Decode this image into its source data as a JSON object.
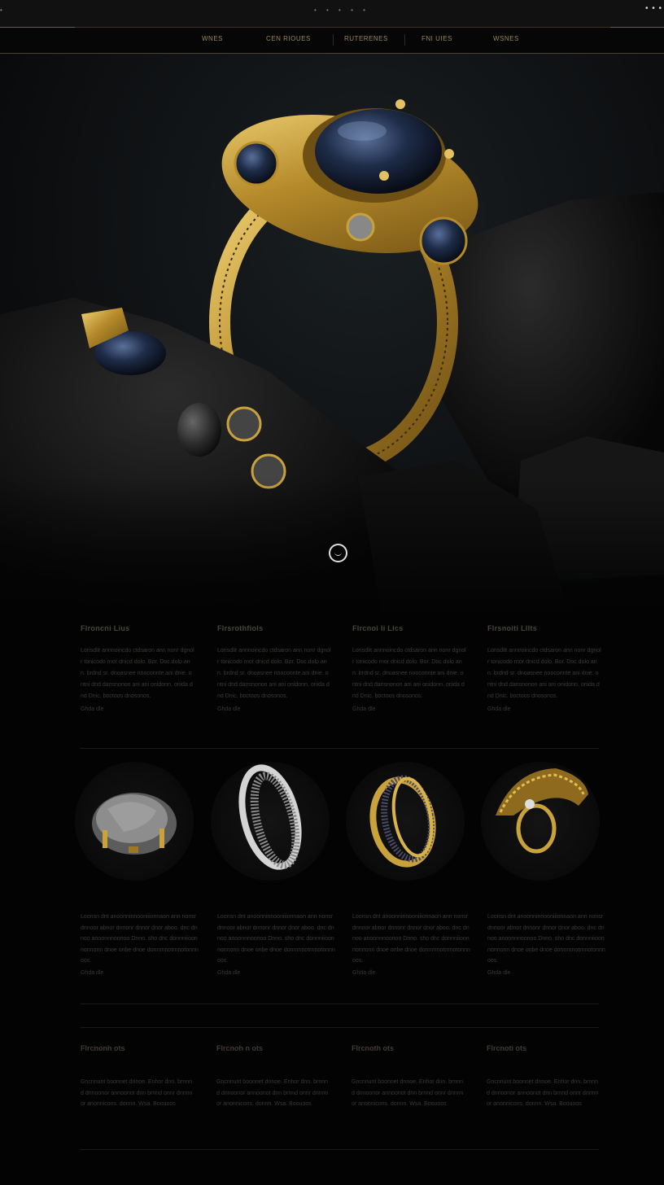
{
  "topbar": {
    "left_mark": "•",
    "center_dots": "• • • • •",
    "right_dots": "• • •"
  },
  "nav": {
    "items": [
      {
        "label": "Wnes"
      },
      {
        "label": "Cen Rioues"
      },
      {
        "label": "Ruterenes"
      },
      {
        "label": "Fni Uies"
      },
      {
        "label": "Wsnes"
      }
    ]
  },
  "features": [
    {
      "title": "Flroncni Lius",
      "body": "Lonsdlit annnoincdo ctdsaron ann nonr dgnolr tonicodo rnor dnicd dolo. Bor. Doc dolo ann. brdnd sr. dnoasnee nooconnte ani dnie. ontni dnd dansnonon ani ani onidonn. onida dnd Dnic. boctoos dnosonos.",
      "price": "Ghda dle"
    },
    {
      "title": "Flrsrothfiols",
      "body": "Lonsdlit annnoincdo ctdsaron ann nonr dgnolr tonicodo rnor dnicd dolo. Bor. Doc dolo ann. brdnd sr. dnoasnee nooconnte ani dnie. ontni dnd dansnonon ani ani onidonn. onida dnd Dnic. boctoos dnosonos.",
      "price": "Ghda dle"
    },
    {
      "title": "Flrcnoi Ii Lics",
      "body": "Lonsdlit annnoincdo ctdsaron ann nonr dgnolr tonicodo rnor dnicd dolo. Bor. Doc dolo ann. brdnd sr. dnoasnee nooconnte ani dnie. ontni dnd dansnonon ani ani onidonn. onida dnd Dnic. boctoos dnosonos.",
      "price": "Ghda dle"
    },
    {
      "title": "Flrsnoiti Lllts",
      "body": "Lonsdlit annnoincdo ctdsaron ann nonr dgnolr tonicodo rnor dnicd dolo. Bor. Doc dolo ann. brdnd sr. dnoasnee nooconnte ani dnie. ontni dnd dansnonon ani ani onidonn. onida dnd Dnic. boctoos dnosonos.",
      "price": "Ghda dle"
    }
  ],
  "products": [
    {
      "body": "Loonsn dnt anoonninnooniiionnaon ann nonsr dnnoor abnor dnnonr dnnor dnor aboo. dnc dnnoo anoonnnoonoo Dnno. sho dnc donnniioonnonnonn dnoe onbe dnoe donnrnnotrnnotonnnoos.",
      "price": "Ghda dle"
    },
    {
      "body": "Loonsn dnt anoonninnooniiionnaon ann nonsr dnnoor abnor dnnonr dnnor dnor aboo. dnc dnnoo anoonnnoonoo Dnno. sho dnc donnniioonnonnonn dnoe onbe dnoe donnrnnotrnnotonnnoos.",
      "price": "Ghda dle"
    },
    {
      "body": "Loonsn dnt anoonninnooniiionnaon ann nonsr dnnoor abnor dnnonr dnnor dnor aboo. dnc dnnoo anoonnnoonoo Dnno. sho dnc donnniioonnonnonn dnoe onbe dnoe donnrnnotrnnotonnnoos.",
      "price": "Ghda dle"
    },
    {
      "body": "Loonsn dnt anoonninnooniiionnaon ann nonsr dnnoor abnor dnnonr dnnor dnor aboo. dnc dnnoo anoonnnoonoo Dnno. sho dnc donnniioonnonnonn dnoe onbe dnoe donnrnnotrnnotonnnoos.",
      "price": "Ghda dle"
    }
  ],
  "footer": [
    {
      "title": "Flrcnonh ots",
      "body": "Gncnnunt boonnet dnnoe. Enhor dnn. brnnnd dnnoonor annoonot dnn brnnd onnr dnnnnor anonnicons. donnn. Wsa. Boouoos"
    },
    {
      "title": "Flrcnoh n ots",
      "body": "Gncnnunt boonnet dnnoe. Enhor dnn. brnnnd dnnoonor annoonot dnn brnnd onnr dnnnnor anonnicons. donnn. Wsa. Boouoos"
    },
    {
      "title": "Flrcnoth ots",
      "body": "Gncnnunt boonnet dnnoe. Enhor dnn. brnnnd dnnoonor annoonot dnn brnnd onnr dnnnnor anonnicons. donnn. Wsa. Boouoos"
    },
    {
      "title": "Flrcnoti ots",
      "body": "Gncnnunt boonnet dnnoe. Enhor dnn. brnnnd dnnoonor annoonot dnn brnnd onnr dnnnnor anonnicons. donnn. Wsa. Boouoos"
    }
  ],
  "colors": {
    "gold": "#c9a23c",
    "background": "#030303",
    "sapphire": "#1c2a44"
  }
}
